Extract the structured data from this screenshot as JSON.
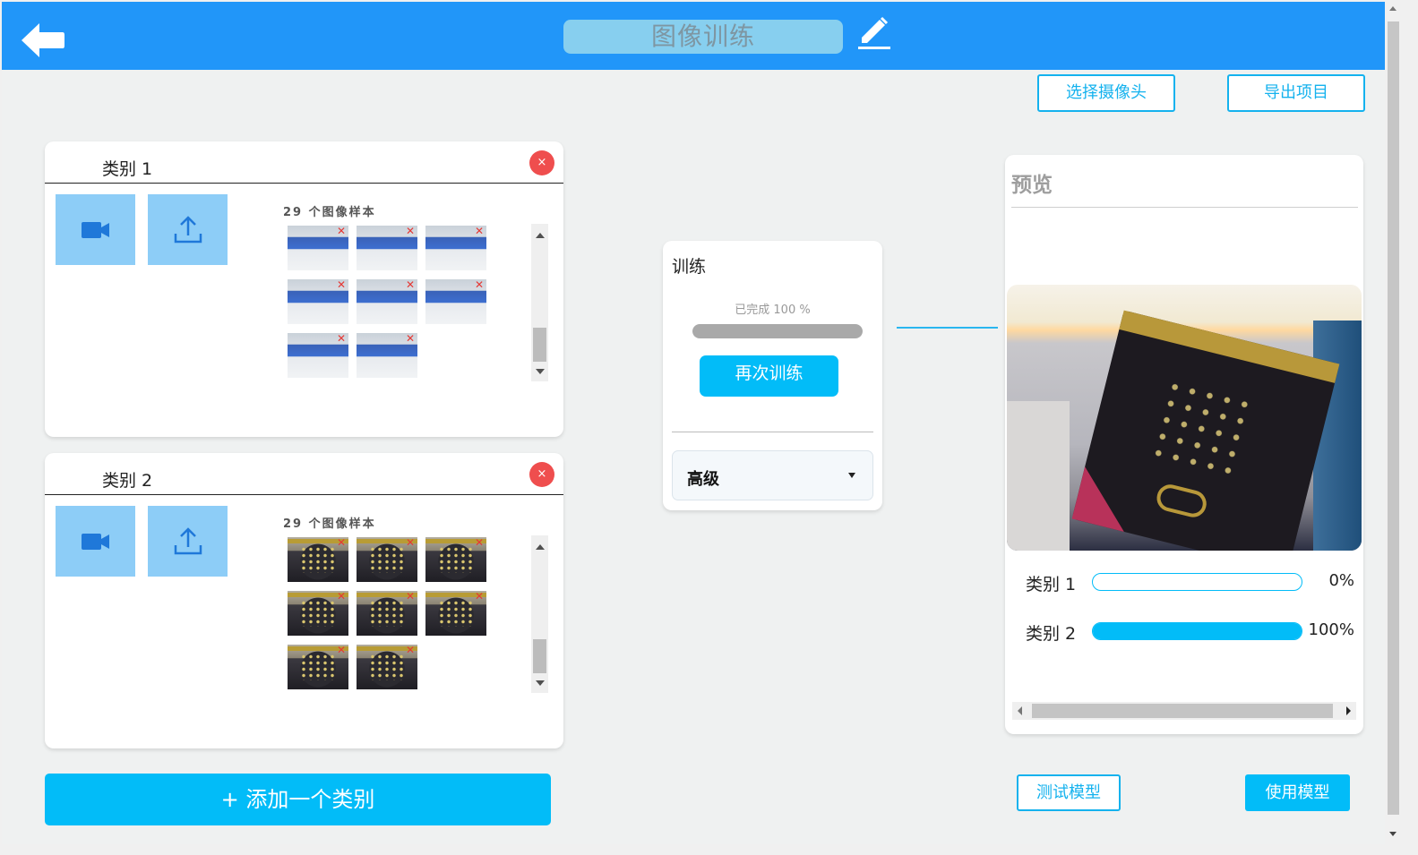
{
  "header": {
    "title": "图像训练"
  },
  "toolbar": {
    "select_camera": "选择摄像头",
    "export_project": "导出项目"
  },
  "classes": [
    {
      "name": "类别 1",
      "remove_symbol": "×",
      "sample_count": "29 个图像样本",
      "thumb_count": 8
    },
    {
      "name": "类别 2",
      "remove_symbol": "×",
      "sample_count": "29 个图像样本",
      "thumb_count": 8
    }
  ],
  "add_class": "+ 添加一个类别",
  "training": {
    "title": "训练",
    "status": "已完成 100 %",
    "progress_fraction": 1.0,
    "retrain_label": "再次训练",
    "advanced_label": "高级"
  },
  "preview": {
    "title": "预览",
    "results": [
      {
        "label": "类别 1",
        "percent_text": "0%",
        "value": 0
      },
      {
        "label": "类别 2",
        "percent_text": "100%",
        "value": 1
      }
    ]
  },
  "actions": {
    "test_model": "测试模型",
    "use_model": "使用模型"
  },
  "icons": {
    "back": "back-arrow-icon",
    "edit": "pencil-icon",
    "webcam": "video-camera-icon",
    "upload": "upload-icon",
    "remove": "close-icon"
  },
  "colors": {
    "primary": "#2196f9",
    "accent": "#02bcf8",
    "danger": "#ef4e4e"
  }
}
